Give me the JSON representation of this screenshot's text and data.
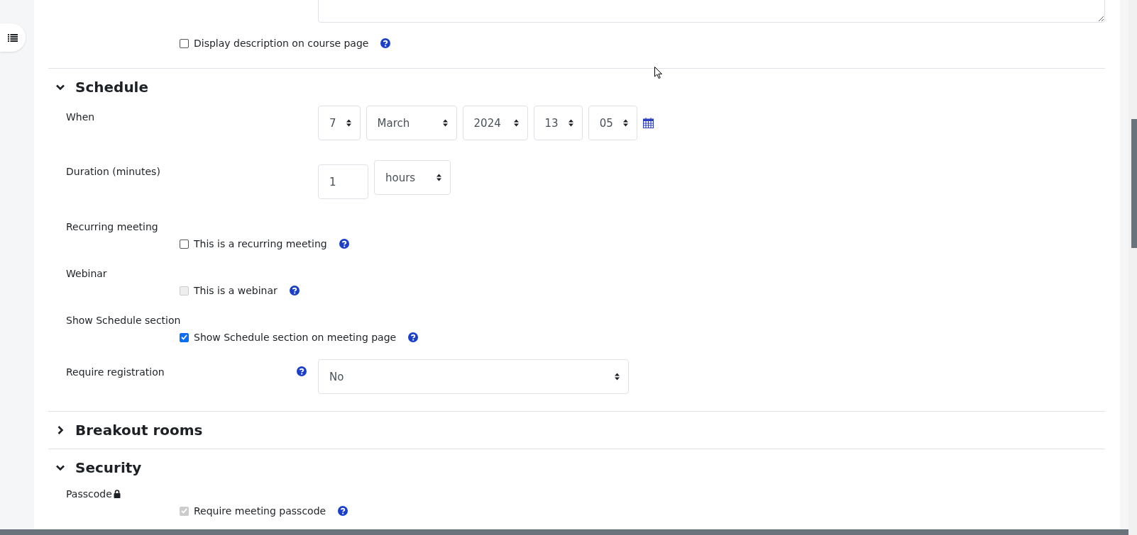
{
  "description_option": {
    "label": "Display description on course page",
    "checked": false,
    "disabled": false
  },
  "sections": [
    {
      "title": "Schedule",
      "expanded": true,
      "fields": [
        {
          "kind": "datetime",
          "label": "When",
          "selects": [
            "7",
            "March",
            "2024",
            "13",
            "05"
          ]
        },
        {
          "kind": "duration",
          "label": "Duration (minutes)",
          "value": "1",
          "unit": "hours"
        },
        {
          "kind": "checkbox",
          "label": "Recurring meeting",
          "locked": false,
          "option": "This is a recurring meeting",
          "checked": false,
          "disabled": false
        },
        {
          "kind": "checkbox",
          "label": "Webinar",
          "locked": false,
          "option": "This is a webinar",
          "checked": false,
          "disabled": true
        },
        {
          "kind": "checkbox",
          "label": "Show Schedule section",
          "locked": false,
          "option": "Show Schedule section on meeting page",
          "checked": true,
          "disabled": false
        },
        {
          "kind": "select",
          "label": "Require registration",
          "value": "No"
        }
      ]
    },
    {
      "title": "Breakout rooms",
      "expanded": false
    },
    {
      "title": "Security",
      "expanded": true,
      "fields": [
        {
          "kind": "checkbox",
          "label": "Passcode",
          "locked": true,
          "option": "Require meeting passcode",
          "checked": true,
          "disabled": true
        }
      ]
    }
  ]
}
